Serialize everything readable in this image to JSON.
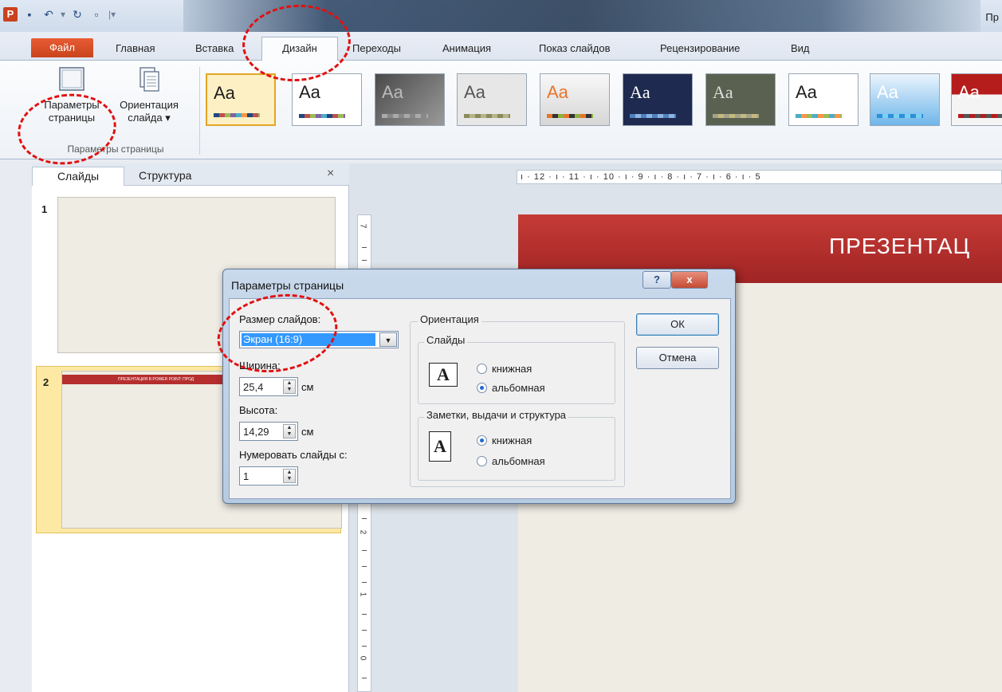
{
  "app": {
    "title": "Пр"
  },
  "tabs": [
    "Файл",
    "Главная",
    "Вставка",
    "Дизайн",
    "Переходы",
    "Анимация",
    "Показ слайдов",
    "Рецензирование",
    "Вид"
  ],
  "ribbon": {
    "page_setup_line1": "Параметры",
    "page_setup_line2": "страницы",
    "orientation_line1": "Ориентация",
    "orientation_line2": "слайда ▾",
    "group_label": "Параметры страницы",
    "theme_label": "Aa"
  },
  "left_pane": {
    "tabs": [
      "Слайды",
      "Структура"
    ],
    "close": "×",
    "slides": [
      {
        "num": "1",
        "text": ""
      },
      {
        "num": "2",
        "text": "ПРЕЗЕНТАЦИЯ В POWER POINT: ПРОД"
      }
    ]
  },
  "ruler": {
    "h": "ı · 12 · ı · 11 · ı · 10 · ı · 9 · ı · 8 · ı · 7 · ı · 6 · ı · 5",
    "v_nums": [
      "7",
      "2",
      "1",
      "0"
    ]
  },
  "slide": {
    "title": "ПРЕЗЕНТАЦ"
  },
  "dialog": {
    "title": "Параметры страницы",
    "help": "?",
    "close": "x",
    "size_label": "Размер слайдов:",
    "size_value": "Экран (16:9)",
    "width_label": "Ширина:",
    "width_value": "25,4",
    "width_unit": "см",
    "height_label": "Высота:",
    "height_value": "14,29",
    "height_unit": "см",
    "number_label": "Нумеровать слайды с:",
    "number_value": "1",
    "orientation_title": "Ориентация",
    "slides_group": "Слайды",
    "portrait": "книжная",
    "landscape": "альбомная",
    "notes_group": "Заметки, выдачи и структура",
    "ok": "ОК",
    "cancel": "Отмена",
    "icon_letter": "A"
  }
}
